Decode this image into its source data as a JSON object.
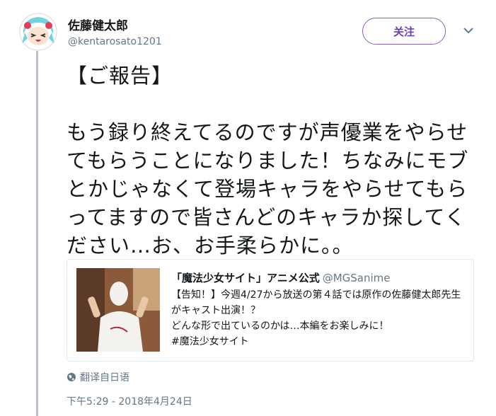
{
  "user": {
    "display_name": "佐藤健太郎",
    "handle": "@kentarosato1201",
    "follow_label": "关注"
  },
  "tweet": {
    "text": "【ご報告】\n\nもう録り終えてるのですが声優業をやらせてもらうことになりました！ちなみにモブとかじゃなくて登場キャラをやらせてもらってますので皆さんどのキャラか探してください…お、お手柔らかに。。",
    "translate_label": "翻译自日语",
    "timestamp": "下午5:29 - 2018年4月24日"
  },
  "quote": {
    "author": "「魔法少女サイト」アニメ公式",
    "handle": "@MGSanime",
    "text": "【告知！】今週4/27から放送の第４話では原作の佐藤健太郎先生がキャスト出演！？\nどんな形で出ているのかは…本編をお楽しみに！\n#魔法少女サイト"
  },
  "icons": {
    "avatar": "anime-avatar-icon",
    "menu": "chevron-down-icon",
    "translate": "globe-icon"
  },
  "colors": {
    "accent": "#8a60b5",
    "thread_line": "#c5b7d8",
    "secondary_text": "#657786"
  }
}
